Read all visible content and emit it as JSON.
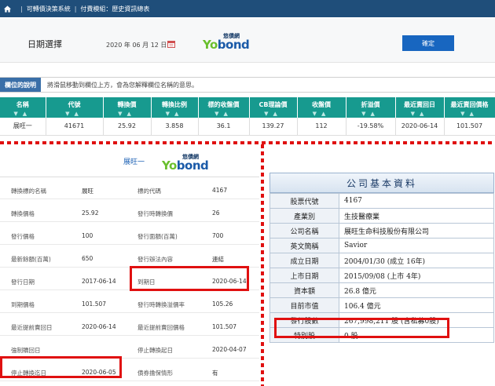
{
  "nav": {
    "system": "可轉債決策系統",
    "module": "付費模組：歷史資訊總表"
  },
  "date_panel": {
    "label": "日期選擇",
    "value": "2020 年 06 月 12 日",
    "confirm_label": "確定"
  },
  "logo": {
    "cn": "悠債網",
    "en_prefix": "Yo",
    "en_suffix": "bond"
  },
  "hint": {
    "tag": "欄位的說明",
    "text": "將滑鼠移動到欄位上方，會為您解釋欄位名稱的意思。"
  },
  "grid": {
    "headers": [
      "名稱",
      "代號",
      "轉換價",
      "轉換比例",
      "標的收盤價",
      "CB理論價",
      "收盤價",
      "折溢價",
      "最近賣回日",
      "最近賣回價格"
    ],
    "row": [
      "展旺一",
      "41671",
      "25.92",
      "3.858",
      "36.1",
      "139.27",
      "112",
      "-19.58%",
      "2020-06-14",
      "101.507"
    ]
  },
  "detail": {
    "name": "展旺一",
    "rows": [
      [
        "轉換標的名稱",
        "展旺",
        "標的代碼",
        "4167"
      ],
      [
        "轉換價格",
        "25.92",
        "發行時轉換價",
        "26"
      ],
      [
        "發行價格",
        "100",
        "發行面額(百萬)",
        "700"
      ],
      [
        "最新餘額(百萬)",
        "650",
        "發行辦法內容",
        "連結"
      ],
      [
        "發行日期",
        "2017-06-14",
        "到期日",
        "2020-06-14"
      ],
      [
        "到期價格",
        "101.507",
        "發行時轉換溢價率",
        "105.26"
      ],
      [
        "最近提前賣回日",
        "2020-06-14",
        "最近提前賣回價格",
        "101.507"
      ],
      [
        "強制贖回日",
        "",
        "停止轉換起日",
        "2020-04-07"
      ],
      [
        "停止轉換迄日",
        "2020-06-05",
        "債券擔保情形",
        "有"
      ]
    ]
  },
  "company": {
    "title": "公司基本資料",
    "rows": [
      [
        "股票代號",
        "4167"
      ],
      [
        "產業別",
        "生技醫療業"
      ],
      [
        "公司名稱",
        "展旺生命科技股份有限公司"
      ],
      [
        "英文簡稱",
        "Savior"
      ],
      [
        "成立日期",
        "2004/01/30  (成立 16年)"
      ],
      [
        "上市日期",
        "2015/09/08  (上市 4年)"
      ],
      [
        "資本額",
        "26.8 億元"
      ],
      [
        "目前市值",
        "106.4 億元"
      ],
      [
        "發行股數",
        "267,998,211 股 (含私募0股)"
      ],
      [
        "特別股",
        "0 股"
      ]
    ]
  },
  "colors": {
    "nav": "#1f4e7a",
    "grid_header": "#179a8f",
    "highlight": "#e01010",
    "button": "#1866c0"
  }
}
